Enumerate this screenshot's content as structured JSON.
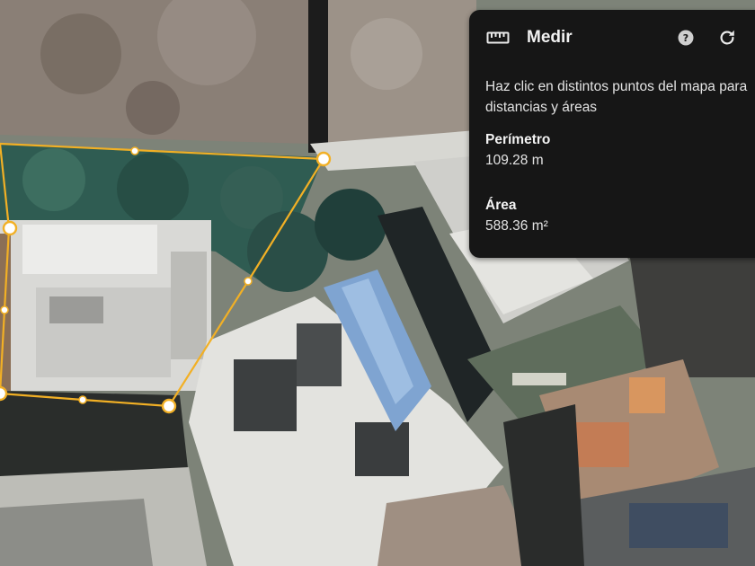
{
  "measure_panel": {
    "title": "Medir",
    "ruler_icon": "ruler-icon",
    "help_icon": "help-circle-icon",
    "reset_icon": "refresh-icon",
    "instructions_line1": "Haz clic en distintos puntos del mapa para",
    "instructions_line2": "distancias y áreas",
    "perimeter_label": "Perímetro",
    "perimeter_value": "109.28 m",
    "area_label": "Área",
    "area_value": "588.36 m²"
  },
  "colors": {
    "measure_line": "#f2b025",
    "panel_background": "#161616"
  }
}
